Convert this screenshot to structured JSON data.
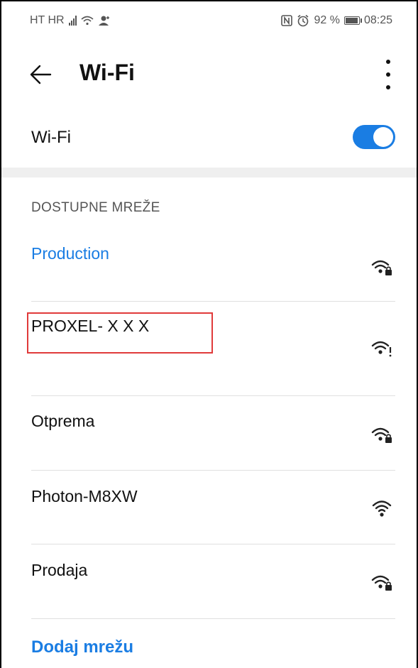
{
  "status_bar": {
    "carrier": "HT HR",
    "battery": "92 %",
    "time": "08:25"
  },
  "header": {
    "title": "Wi-Fi"
  },
  "wifi_toggle": {
    "label": "Wi-Fi",
    "enabled": true
  },
  "section": {
    "title": "DOSTUPNE MREŽE"
  },
  "networks": [
    {
      "name": "Production",
      "connected": true,
      "secured": true,
      "icon": "wifi-lock-icon"
    },
    {
      "name": "PROXEL- X X X",
      "connected": false,
      "secured": false,
      "icon": "wifi-warning-icon"
    },
    {
      "name": "Otprema",
      "connected": false,
      "secured": true,
      "icon": "wifi-lock-icon"
    },
    {
      "name": "Photon-M8XW",
      "connected": false,
      "secured": false,
      "icon": "wifi-icon"
    },
    {
      "name": "Prodaja",
      "connected": false,
      "secured": true,
      "icon": "wifi-lock-icon"
    }
  ],
  "footer": {
    "add_network": "Dodaj mrežu"
  },
  "colors": {
    "accent": "#1a7de3",
    "highlight": "#e03a3a"
  }
}
